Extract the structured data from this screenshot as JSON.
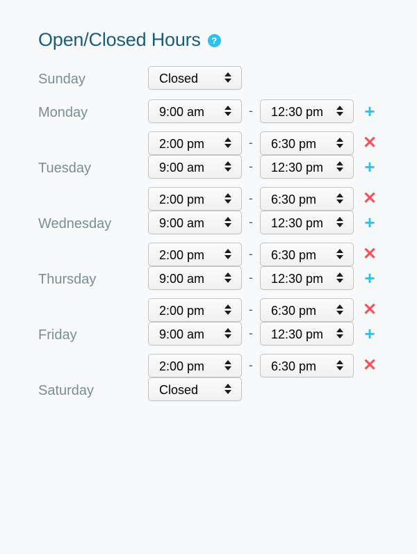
{
  "panel": {
    "title": "Open/Closed Hours",
    "help_icon": "question-circle-icon",
    "help_label": "?",
    "separator": "-",
    "add_label": "+",
    "remove_label": "✕",
    "accent_color": "#29c3ef",
    "remove_color": "#f5525a",
    "title_color": "#1a5d7a",
    "label_color": "#7b8d95",
    "background_color": "#f7f9fa"
  },
  "closed_label": "Closed",
  "time_options": [
    "Closed",
    "9:00 am",
    "12:30 pm",
    "2:00 pm",
    "6:30 pm"
  ],
  "days": [
    {
      "label": "Sunday",
      "closed": true,
      "status": "Closed",
      "ranges": []
    },
    {
      "label": "Monday",
      "closed": false,
      "ranges": [
        {
          "open": "9:00 am",
          "close": "12:30 pm",
          "action": "add"
        },
        {
          "open": "2:00 pm",
          "close": "6:30 pm",
          "action": "remove"
        }
      ]
    },
    {
      "label": "Tuesday",
      "closed": false,
      "ranges": [
        {
          "open": "9:00 am",
          "close": "12:30 pm",
          "action": "add"
        },
        {
          "open": "2:00 pm",
          "close": "6:30 pm",
          "action": "remove"
        }
      ]
    },
    {
      "label": "Wednesday",
      "closed": false,
      "ranges": [
        {
          "open": "9:00 am",
          "close": "12:30 pm",
          "action": "add"
        },
        {
          "open": "2:00 pm",
          "close": "6:30 pm",
          "action": "remove"
        }
      ]
    },
    {
      "label": "Thursday",
      "closed": false,
      "ranges": [
        {
          "open": "9:00 am",
          "close": "12:30 pm",
          "action": "add"
        },
        {
          "open": "2:00 pm",
          "close": "6:30 pm",
          "action": "remove"
        }
      ]
    },
    {
      "label": "Friday",
      "closed": false,
      "ranges": [
        {
          "open": "9:00 am",
          "close": "12:30 pm",
          "action": "add"
        },
        {
          "open": "2:00 pm",
          "close": "6:30 pm",
          "action": "remove"
        }
      ]
    },
    {
      "label": "Saturday",
      "closed": true,
      "status": "Closed",
      "ranges": []
    }
  ]
}
